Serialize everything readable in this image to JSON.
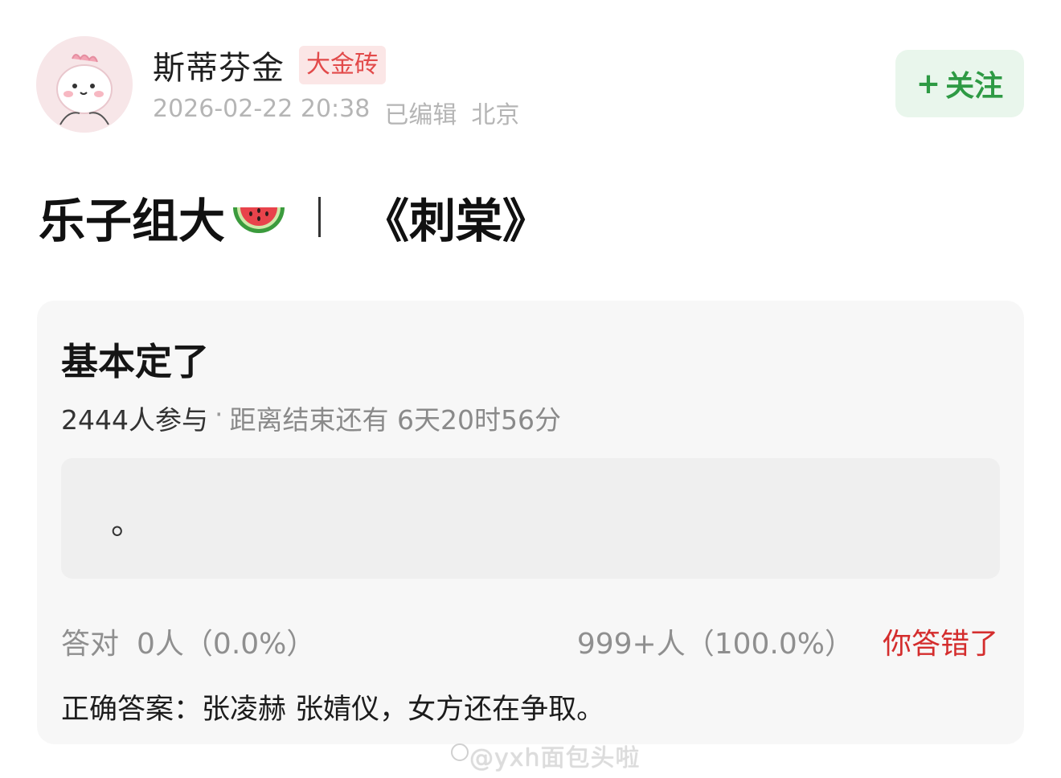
{
  "author": {
    "name": "斯蒂芬金",
    "badge": "大金砖",
    "timestamp": "2026-02-22 20:38",
    "edited": "已编辑",
    "location": "北京"
  },
  "follow_button": {
    "icon": "+",
    "label": "关注"
  },
  "post": {
    "title_left": "乐子组大",
    "title_right": "《刺棠》"
  },
  "quiz": {
    "question": "基本定了",
    "participants": "2444人参与",
    "separator": "·",
    "deadline": "距离结束还有 6天20时56分",
    "option_text": "。",
    "correct_label": "答对",
    "correct_stats": "0人（0.0%）",
    "wrong_stats": "999+人（100.0%）",
    "verdict": "你答错了",
    "answer_label": "正确答案：",
    "answer_text": "张凌赫 张婧仪，女方还在争取。"
  },
  "watermark": "@yxh面包头啦",
  "colors": {
    "follow_green": "#2e9a44",
    "badge_red": "#e24a4a",
    "wrong_red": "#d42d2d"
  }
}
